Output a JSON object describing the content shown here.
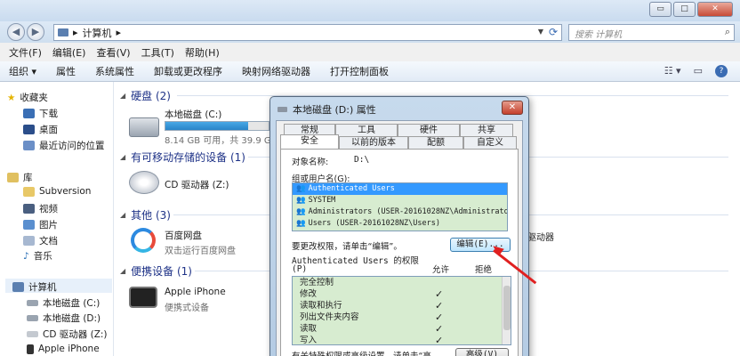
{
  "window": {
    "title_controls": {
      "minimize": "▭",
      "maximize": "□",
      "close": "✕"
    }
  },
  "nav": {
    "back": "◀",
    "forward": "▶",
    "address": "计算机",
    "address_sep": "▸",
    "search_placeholder": "搜索 计算机"
  },
  "menu": [
    "文件(F)",
    "编辑(E)",
    "查看(V)",
    "工具(T)",
    "帮助(H)"
  ],
  "toolbar": [
    "组织 ▾",
    "属性",
    "系统属性",
    "卸载或更改程序",
    "映射网络驱动器",
    "打开控制面板"
  ],
  "sidebar": {
    "favorites": "收藏夹",
    "fav_items": [
      "下载",
      "桌面",
      "最近访问的位置"
    ],
    "library": "库",
    "lib_items": [
      "Subversion",
      "视频",
      "图片",
      "文档",
      "音乐"
    ],
    "computer": "计算机",
    "comp_items": [
      "本地磁盘 (C:)",
      "本地磁盘 (D:)",
      "CD 驱动器 (Z:)",
      "Apple iPhone"
    ]
  },
  "content": {
    "groups": [
      {
        "title": "硬盘 (2)"
      },
      {
        "title": "有可移动存储的设备 (1)"
      },
      {
        "title": "其他 (3)"
      },
      {
        "title": "便携设备 (1)"
      }
    ],
    "disk_c": {
      "name": "本地磁盘 (C:)",
      "free": "8.14 GB 可用，共 39.9 GB",
      "used_fraction": 0.8
    },
    "cd": {
      "name": "CD 驱动器 (Z:)"
    },
    "baidu": {
      "name": "百度网盘",
      "sub": "双击运行百度网盘"
    },
    "iphone": {
      "name": "Apple iPhone",
      "sub": "便携式设备"
    },
    "hidden_right": "驱动器"
  },
  "dialog": {
    "title": "本地磁盘 (D:) 属性",
    "close": "✕",
    "tabs_row1": [
      "常规",
      "工具",
      "硬件",
      "共享"
    ],
    "tabs_row2": [
      "安全",
      "以前的版本",
      "配额",
      "自定义"
    ],
    "object_label": "对象名称:",
    "object_value": "D:\\",
    "group_label": "组或用户名(G):",
    "users": [
      "Authenticated Users",
      "SYSTEM",
      "Administrators (USER-20161028NZ\\Administrators)",
      "Users (USER-20161028NZ\\Users)"
    ],
    "change_text": "要更改权限，请单击“编辑”。",
    "edit_button": "编辑(E)...",
    "perm_title": "Authenticated Users 的权限",
    "perm_p": "(P)",
    "allow": "允许",
    "deny": "拒绝",
    "permissions": [
      {
        "name": "完全控制",
        "allow": ""
      },
      {
        "name": "修改",
        "allow": "✓"
      },
      {
        "name": "读取和执行",
        "allow": "✓"
      },
      {
        "name": "列出文件夹内容",
        "allow": "✓"
      },
      {
        "name": "读取",
        "allow": "✓"
      },
      {
        "name": "写入",
        "allow": "✓"
      }
    ],
    "advanced_text": "有关特殊权限或高级设置，请单击“高",
    "advanced_button": "高级(V)"
  },
  "colors": {
    "accent": "#1e3287",
    "selection": "#3399ff",
    "list_bg": "#d7ecd0",
    "arrow": "#e02020"
  }
}
